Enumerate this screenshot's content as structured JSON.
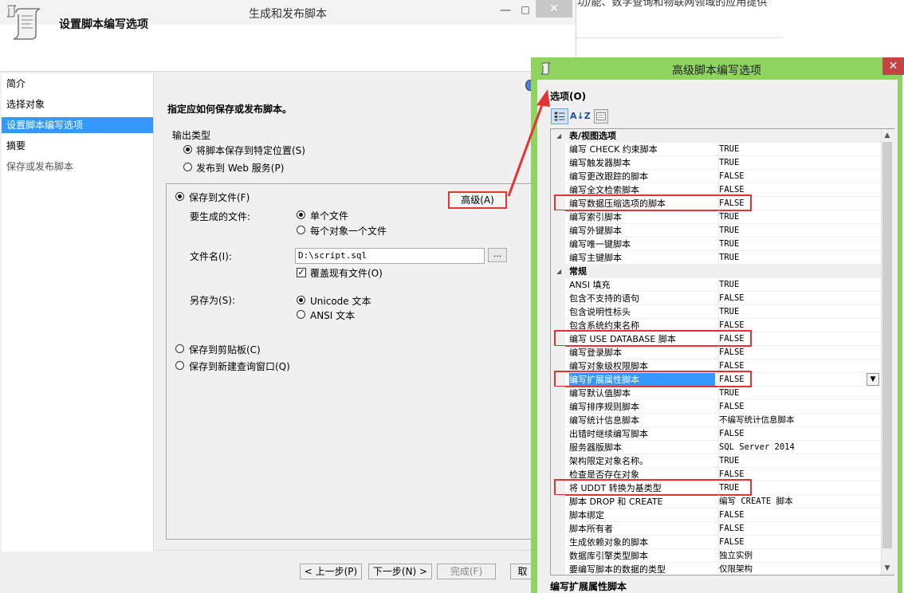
{
  "background_page": {
    "snippet": "功/能、数学查询和物联网领域的应用提供"
  },
  "wizard": {
    "title": "生成和发布脚本",
    "min_glyph": "—",
    "max_glyph": "□",
    "close_glyph": "✕",
    "header_title": "设置脚本编写选项",
    "nav": [
      "简介",
      "选择对象",
      "设置脚本编写选项",
      "摘要",
      "保存或发布脚本"
    ],
    "instruction": "指定应如何保存或发布脚本。",
    "output_type_label": "输出类型",
    "output_options": [
      "将脚本保存到特定位置(S)",
      "发布到 Web 服务(P)"
    ],
    "save_to_file": "保存到文件(F)",
    "advanced_button": "高级(A)",
    "files_to_generate_label": "要生成的文件:",
    "file_options": [
      "单个文件",
      "每个对象一个文件"
    ],
    "file_name_label": "文件名(I):",
    "file_name_value": "D:\\script.sql",
    "browse_label": "...",
    "overwrite_label": "覆盖现有文件(O)",
    "save_as_label": "另存为(S):",
    "encoding_options": [
      "Unicode 文本",
      "ANSI 文本"
    ],
    "save_clipboard": "保存到剪贴板(C)",
    "save_new_query": "保存到新建查询窗口(Q)",
    "footer": {
      "prev": "< 上一步(P)",
      "next": "下一步(N) >",
      "finish": "完成(F)",
      "cancel": "取"
    }
  },
  "advanced": {
    "title": "高级脚本编写选项",
    "close_glyph": "✕",
    "options_title": "选项(O)",
    "sort_az_label": "A↓Z",
    "rows": [
      {
        "type": "cat",
        "name": "表/视图选项",
        "value": ""
      },
      {
        "type": "row",
        "name": "编写 CHECK 约束脚本",
        "value": "TRUE"
      },
      {
        "type": "row",
        "name": "编写触发器脚本",
        "value": "TRUE"
      },
      {
        "type": "row",
        "name": "编写更改跟踪的脚本",
        "value": "FALSE"
      },
      {
        "type": "row",
        "name": "编写全文检索脚本",
        "value": "FALSE"
      },
      {
        "type": "row",
        "name": "编写数据压缩选项的脚本",
        "value": "FALSE",
        "hl": true
      },
      {
        "type": "row",
        "name": "编写索引脚本",
        "value": "TRUE"
      },
      {
        "type": "row",
        "name": "编写外键脚本",
        "value": "TRUE"
      },
      {
        "type": "row",
        "name": "编写唯一键脚本",
        "value": "TRUE"
      },
      {
        "type": "row",
        "name": "编写主键脚本",
        "value": "TRUE"
      },
      {
        "type": "cat",
        "name": "常规",
        "value": ""
      },
      {
        "type": "row",
        "name": "ANSI 填充",
        "value": "TRUE"
      },
      {
        "type": "row",
        "name": "包含不支持的语句",
        "value": "FALSE"
      },
      {
        "type": "row",
        "name": "包含说明性标头",
        "value": "TRUE"
      },
      {
        "type": "row",
        "name": "包含系统约束名称",
        "value": "FALSE"
      },
      {
        "type": "row",
        "name": "编写 USE DATABASE 脚本",
        "value": "FALSE",
        "hl": true
      },
      {
        "type": "row",
        "name": "编写登录脚本",
        "value": "FALSE"
      },
      {
        "type": "row",
        "name": "编写对象级权限脚本",
        "value": "FALSE"
      },
      {
        "type": "row",
        "name": "编写扩展属性脚本",
        "value": "FALSE",
        "hl": true,
        "sel": true
      },
      {
        "type": "row",
        "name": "编写默认值脚本",
        "value": "TRUE"
      },
      {
        "type": "row",
        "name": "编写排序规则脚本",
        "value": "FALSE"
      },
      {
        "type": "row",
        "name": "编写统计信息脚本",
        "value": "不编写统计信息脚本"
      },
      {
        "type": "row",
        "name": "出错时继续编写脚本",
        "value": "FALSE"
      },
      {
        "type": "row",
        "name": "服务器版脚本",
        "value": "SQL Server 2014"
      },
      {
        "type": "row",
        "name": "架构限定对象名称。",
        "value": "TRUE"
      },
      {
        "type": "row",
        "name": "检查是否存在对象",
        "value": "FALSE"
      },
      {
        "type": "row",
        "name": "将 UDDT 转换为基类型",
        "value": "TRUE",
        "hl": true
      },
      {
        "type": "row",
        "name": "脚本 DROP 和 CREATE",
        "value": "编写 CREATE 脚本"
      },
      {
        "type": "row",
        "name": "脚本绑定",
        "value": "FALSE"
      },
      {
        "type": "row",
        "name": "脚本所有者",
        "value": "FALSE"
      },
      {
        "type": "row",
        "name": "生成依赖对象的脚本",
        "value": "FALSE"
      },
      {
        "type": "row",
        "name": "数据库引擎类型脚本",
        "value": "独立实例"
      },
      {
        "type": "row",
        "name": "要编写脚本的数据的类型",
        "value": "仅限架构"
      }
    ],
    "description_title": "编写扩展属性脚本"
  },
  "colors": {
    "advanced_titlebar": "#8fd461",
    "selection": "#3399ff",
    "annotation_red": "#e53333"
  }
}
